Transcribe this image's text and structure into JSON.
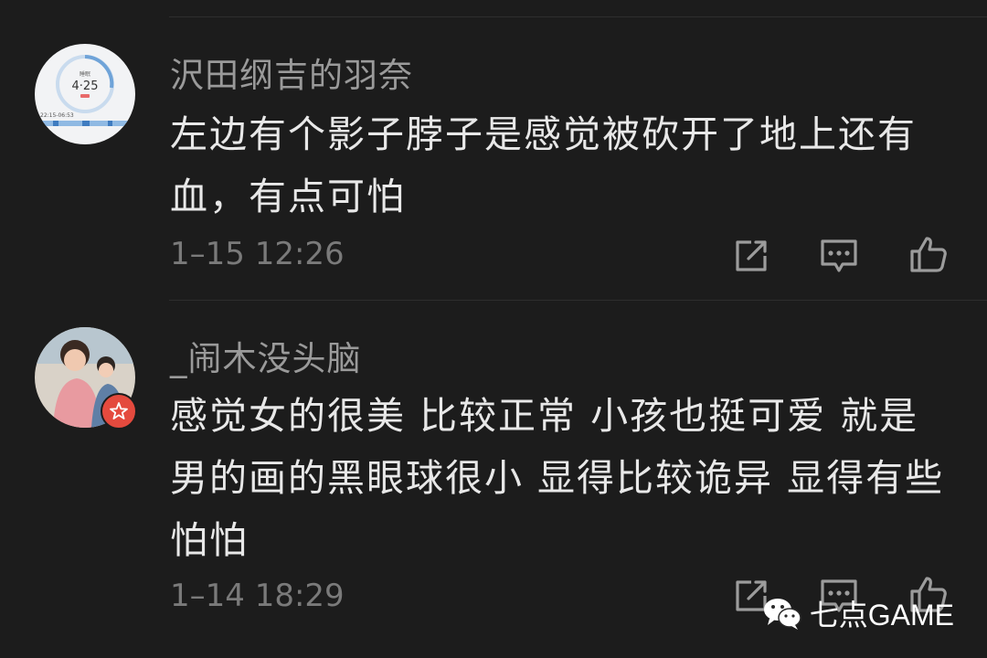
{
  "comments": [
    {
      "username": "沢田纲吉的羽奈",
      "content": "左边有个影子脖子是感觉被砍开了地上还有血，有点可怕",
      "timestamp": "1–15 12:26",
      "avatar": {
        "kind": "alarm-screenshot",
        "clock_text": "4·25",
        "range_text": "22:15-06:53"
      }
    },
    {
      "username": "_闹木没头脑",
      "content": "感觉女的很美 比较正常 小孩也挺可爱 就是男的画的黑眼球很小 显得比较诡异 显得有些怕怕",
      "timestamp": "1–14 18:29",
      "avatar": {
        "kind": "mother-child-photo",
        "badge": "star-badge"
      }
    }
  ],
  "actions": {
    "icons": [
      "share-icon",
      "reply-icon",
      "like-icon"
    ]
  },
  "watermark": {
    "icon": "wechat-icon",
    "text": "七点GAME"
  },
  "colors": {
    "background": "#1c1c1c",
    "username": "#9a9a9a",
    "content": "#e8e8e8",
    "timestamp": "#7a7a7a",
    "icon": "#9c9c9c",
    "badge": "#e44a3e"
  }
}
